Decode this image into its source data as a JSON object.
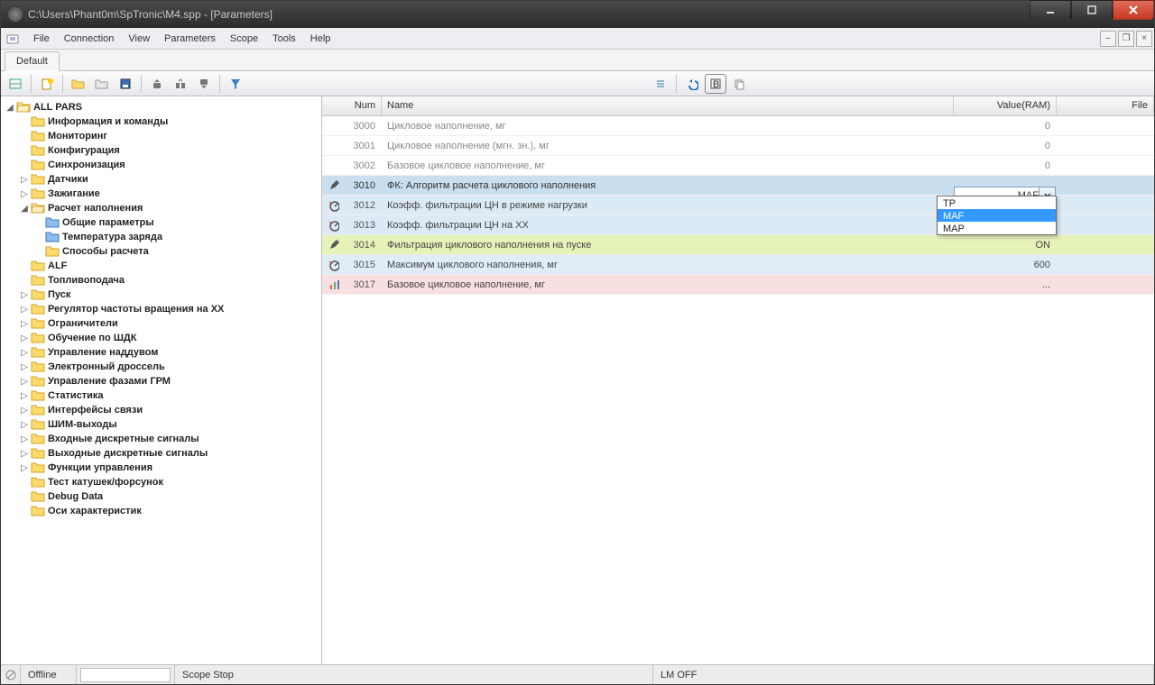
{
  "window": {
    "title": "C:\\Users\\Phant0m\\SpTronic\\M4.spp - [Parameters]"
  },
  "menu": {
    "file": "File",
    "connection": "Connection",
    "view": "View",
    "parameters": "Parameters",
    "scope": "Scope",
    "tools": "Tools",
    "help": "Help"
  },
  "tab": "Default",
  "columns": {
    "num": "Num",
    "name": "Name",
    "value": "Value(RAM)",
    "file": "File"
  },
  "tree": {
    "root": "ALL PARS",
    "items": [
      {
        "label": "Информация и команды",
        "exp": false,
        "leaf": true
      },
      {
        "label": "Мониторинг",
        "exp": false,
        "leaf": true
      },
      {
        "label": "Конфигурация",
        "exp": false,
        "leaf": true
      },
      {
        "label": "Синхронизация",
        "exp": false,
        "leaf": true
      },
      {
        "label": "Датчики",
        "exp": true,
        "leaf": false
      },
      {
        "label": "Зажигание",
        "exp": true,
        "leaf": false
      },
      {
        "label": "Расчет наполнения",
        "exp": true,
        "leaf": false,
        "open": true,
        "children": [
          {
            "label": "Общие параметры",
            "color": "blue"
          },
          {
            "label": "Температура заряда",
            "color": "blue"
          },
          {
            "label": "Способы расчета",
            "color": "yellow"
          }
        ]
      },
      {
        "label": "ALF",
        "exp": false,
        "leaf": true
      },
      {
        "label": "Топливоподача",
        "exp": false,
        "leaf": true
      },
      {
        "label": "Пуск",
        "exp": true,
        "leaf": false
      },
      {
        "label": "Регулятор частоты вращения на ХХ",
        "exp": true,
        "leaf": false
      },
      {
        "label": "Ограничители",
        "exp": true,
        "leaf": false
      },
      {
        "label": "Обучение по ШДК",
        "exp": true,
        "leaf": false
      },
      {
        "label": "Управление наддувом",
        "exp": true,
        "leaf": false
      },
      {
        "label": "Электронный дроссель",
        "exp": true,
        "leaf": false
      },
      {
        "label": "Управление фазами ГРМ",
        "exp": true,
        "leaf": false
      },
      {
        "label": "Статистика",
        "exp": true,
        "leaf": false
      },
      {
        "label": "Интерфейсы связи",
        "exp": true,
        "leaf": false
      },
      {
        "label": "ШИМ-выходы",
        "exp": true,
        "leaf": false
      },
      {
        "label": "Входные дискретные сигналы",
        "exp": true,
        "leaf": false
      },
      {
        "label": "Выходные дискретные сигналы",
        "exp": true,
        "leaf": false
      },
      {
        "label": "Функции управления",
        "exp": true,
        "leaf": false
      },
      {
        "label": "Тест катушек/форсунок",
        "exp": false,
        "leaf": true
      },
      {
        "label": "Debug Data",
        "exp": false,
        "leaf": true
      },
      {
        "label": "Оси характеристик",
        "exp": false,
        "leaf": true
      }
    ]
  },
  "rows": [
    {
      "num": "3000",
      "name": "Цикловое наполнение, мг",
      "val": "0",
      "file": "",
      "cls": "gray",
      "icon": ""
    },
    {
      "num": "3001",
      "name": "Цикловое наполнение (мгн. зн.), мг",
      "val": "0",
      "file": "",
      "cls": "gray",
      "icon": ""
    },
    {
      "num": "3002",
      "name": "Базовое цикловое наполнение, мг",
      "val": "0",
      "file": "",
      "cls": "gray",
      "icon": ""
    },
    {
      "num": "3010",
      "name": "ФК: Алгоритм расчета циклового наполнения",
      "val": "MAF",
      "file": "",
      "cls": "blue-sel",
      "icon": "edit"
    },
    {
      "num": "3012",
      "name": "Коэфф. фильтрации ЦН в режиме нагрузки",
      "val": "",
      "file": "",
      "cls": "blue",
      "icon": "dial"
    },
    {
      "num": "3013",
      "name": "Коэфф. фильтрации ЦН на ХХ",
      "val": "",
      "file": "",
      "cls": "blue",
      "icon": "dial"
    },
    {
      "num": "3014",
      "name": "Фильтрация циклового наполнения на пуске",
      "val": "ON",
      "file": "",
      "cls": "green",
      "icon": "edit"
    },
    {
      "num": "3015",
      "name": "Максимум циклового наполнения, мг",
      "val": "600",
      "file": "",
      "cls": "blue-lite",
      "icon": "dial"
    },
    {
      "num": "3017",
      "name": "Базовое цикловое наполнение, мг",
      "val": "...",
      "file": "",
      "cls": "pink",
      "icon": "chart"
    }
  ],
  "dropdown": {
    "selected": "MAF",
    "options": [
      "TP",
      "MAF",
      "MAP"
    ]
  },
  "status": {
    "offline": "Offline",
    "scope": "Scope Stop",
    "lm": "LM OFF"
  }
}
